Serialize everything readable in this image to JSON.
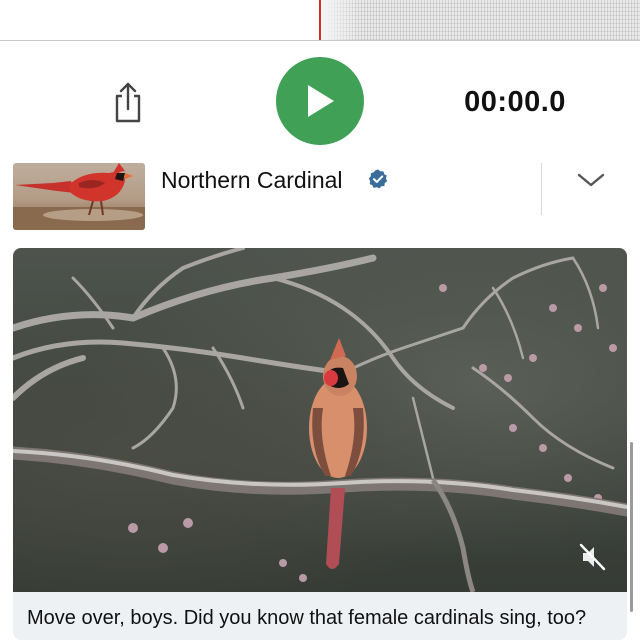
{
  "player": {
    "timer": "00:00.0",
    "share_icon": "share-icon",
    "play_icon": "play-icon",
    "play_color": "#3fa056",
    "playhead_color": "#d62b2b"
  },
  "species": {
    "name": "Northern Cardinal",
    "verified_icon": "verified-badge-icon",
    "verified_color": "#3a6d99",
    "expand_icon": "chevron-down-icon"
  },
  "media": {
    "caption": "Move over, boys. Did you know that female cardinals sing, too?",
    "mute_icon": "muted-speaker-icon"
  }
}
